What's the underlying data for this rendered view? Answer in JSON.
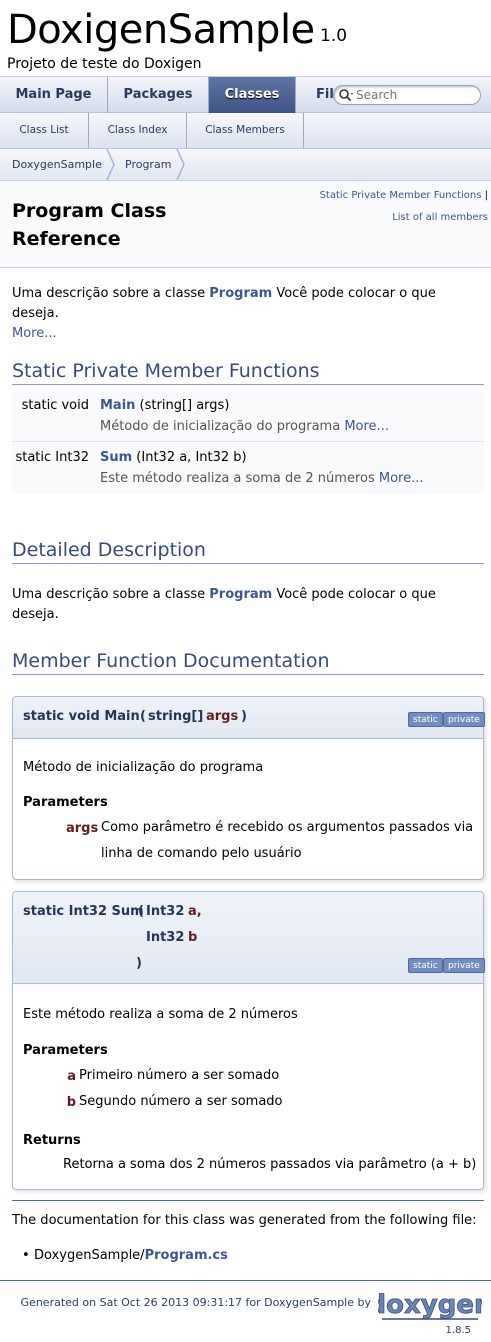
{
  "title_area": {
    "project_name": "DoxigenSample",
    "project_number": "1.0",
    "project_brief": "Projeto de teste do Doxigen"
  },
  "main_tabs": [
    {
      "label": "Main Page"
    },
    {
      "label": "Packages"
    },
    {
      "label": "Classes"
    },
    {
      "label": "Fil"
    }
  ],
  "search": {
    "placeholder": "Search"
  },
  "sub_tabs": [
    {
      "label": "Class List"
    },
    {
      "label": "Class Index"
    },
    {
      "label": "Class Members"
    }
  ],
  "breadcrumb": [
    {
      "label": "DoxygenSample"
    },
    {
      "label": "Program"
    }
  ],
  "header": {
    "summary_link_1": "Static Private Member Functions",
    "summary_sep": "|",
    "summary_link_2": "List of all members",
    "title": "Program Class Reference"
  },
  "brief": {
    "text_before": "Uma descrição sobre a classe ",
    "link": "Program",
    "text_after": " Você pode colocar o que deseja.",
    "more": "More..."
  },
  "section_static_private": {
    "heading": "Static Private Member Functions",
    "members": [
      {
        "left": "static void",
        "name": "Main",
        "args": " (string[] args)",
        "desc": "Método de inicialização do programa ",
        "more": "More..."
      },
      {
        "left": "static Int32",
        "name": "Sum",
        "args": " (Int32 a, Int32 b)",
        "desc": "Este método realiza a soma de 2 números ",
        "more": "More..."
      }
    ]
  },
  "detailed": {
    "heading": "Detailed Description",
    "text_before": "Uma descrição sobre a classe ",
    "link": "Program",
    "text_after": " Você pode colocar o que deseja."
  },
  "member_doc": {
    "heading": "Member Function Documentation",
    "main": {
      "proto_prefix": "static void Main",
      "open": "(",
      "param_type": "string[]",
      "param_name": "args",
      "close": ")",
      "label_static": "static",
      "label_private": "private",
      "body": "Método de inicialização do programa",
      "params_heading": "Parameters",
      "param_doc_name": "args",
      "param_doc_text_1": "Como parâmetro é recebido os argumentos passados via",
      "param_doc_text_2": "linha de comando pelo usuário"
    },
    "sum": {
      "proto_prefix": "static Int32 Sum",
      "open": "(",
      "param1_type": "Int32",
      "param1_name": "a,",
      "param2_type": "Int32",
      "param2_name": "b",
      "close": ")",
      "label_static": "static",
      "label_private": "private",
      "body": "Este método realiza a soma de 2 números",
      "params_heading": "Parameters",
      "param_a_name": "a",
      "param_a_text": "Primeiro número a ser somado",
      "param_b_name": "b",
      "param_b_text": "Segundo número a ser somado",
      "returns_heading": "Returns",
      "returns_text": "Retorna a soma dos 2 números passados via parâmetro (a + b)"
    }
  },
  "generated_from": {
    "text": "The documentation for this class was generated from the following file:",
    "file_prefix": "DoxygenSample/",
    "file_link": "Program.cs"
  },
  "footer": {
    "generated": "Generated on Sat Oct 26 2013 09:31:17 for DoxygenSample by",
    "logo_text": "doxygen",
    "version": "1.8.5"
  },
  "colors": {
    "link": "#3d578c",
    "active_tab": "#3e5485",
    "param_name": "#602020",
    "label_bg": "#728dc1"
  }
}
